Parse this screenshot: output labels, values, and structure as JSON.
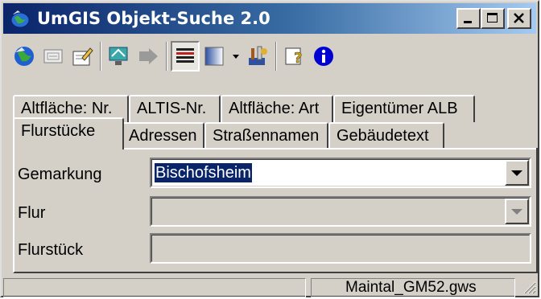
{
  "window": {
    "title": "UmGIS Objekt-Suche 2.0"
  },
  "toolbar": {
    "buttons": [
      {
        "icon": "globe-icon"
      },
      {
        "icon": "card-icon"
      },
      {
        "icon": "edit-icon"
      },
      {
        "icon": "display-icon"
      },
      {
        "icon": "arrow-icon"
      },
      {
        "icon": "list-lines-icon",
        "pressed": true
      },
      {
        "icon": "gradient-icon",
        "has_dropdown": true
      },
      {
        "icon": "tools-icon"
      },
      {
        "icon": "help-icon"
      },
      {
        "icon": "info-icon"
      }
    ]
  },
  "tabs": {
    "row1": [
      "Altfläche: Nr.",
      "ALTIS-Nr.",
      "Altfläche: Art",
      "Eigentümer ALB"
    ],
    "row2": [
      "Flurstücke",
      "Adressen",
      "Straßennamen",
      "Gebäudetext"
    ],
    "active": "Flurstücke"
  },
  "form": {
    "gemarkung_label": "Gemarkung",
    "gemarkung_value": "Bischofsheim",
    "flur_label": "Flur",
    "flur_value": "",
    "flurstueck_label": "Flurstück",
    "flurstueck_value": ""
  },
  "status": {
    "left": "",
    "file": "Maintal_GM52.gws"
  },
  "colors": {
    "title_gradient_start": "#0a246a",
    "title_gradient_end": "#a6caf0",
    "selection": "#0a246a",
    "face": "#d4d0c8"
  }
}
